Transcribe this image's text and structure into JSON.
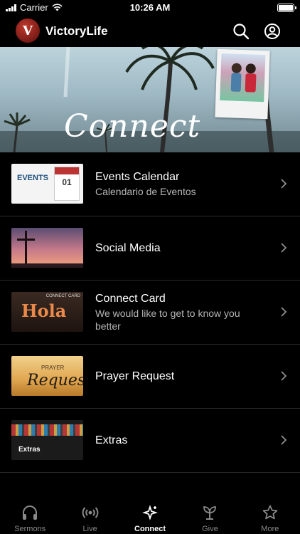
{
  "status": {
    "carrier": "Carrier",
    "time": "10:26 AM"
  },
  "header": {
    "logo_letter": "V",
    "title": "VictoryLife"
  },
  "hero": {
    "title": "Connect"
  },
  "items": [
    {
      "title": "Events Calendar",
      "subtitle": "Calendario de Eventos",
      "thumb_text": "EVENTS",
      "thumb_subtext": "01"
    },
    {
      "title": "Social Media",
      "subtitle": ""
    },
    {
      "title": "Connect Card",
      "subtitle": "We would like to get to know you better",
      "thumb_text": "Hola",
      "thumb_subtext": "CONNECT CARD"
    },
    {
      "title": "Prayer Request",
      "subtitle": "",
      "thumb_text": "Requests",
      "thumb_subtext": "PRAYER"
    },
    {
      "title": "Extras",
      "subtitle": "",
      "thumb_text": "Extras"
    }
  ],
  "tabs": [
    {
      "label": "Sermons",
      "icon": "headphones-icon"
    },
    {
      "label": "Live",
      "icon": "broadcast-icon"
    },
    {
      "label": "Connect",
      "icon": "sparkle-icon",
      "active": true
    },
    {
      "label": "Give",
      "icon": "plant-icon"
    },
    {
      "label": "More",
      "icon": "star-icon"
    }
  ]
}
